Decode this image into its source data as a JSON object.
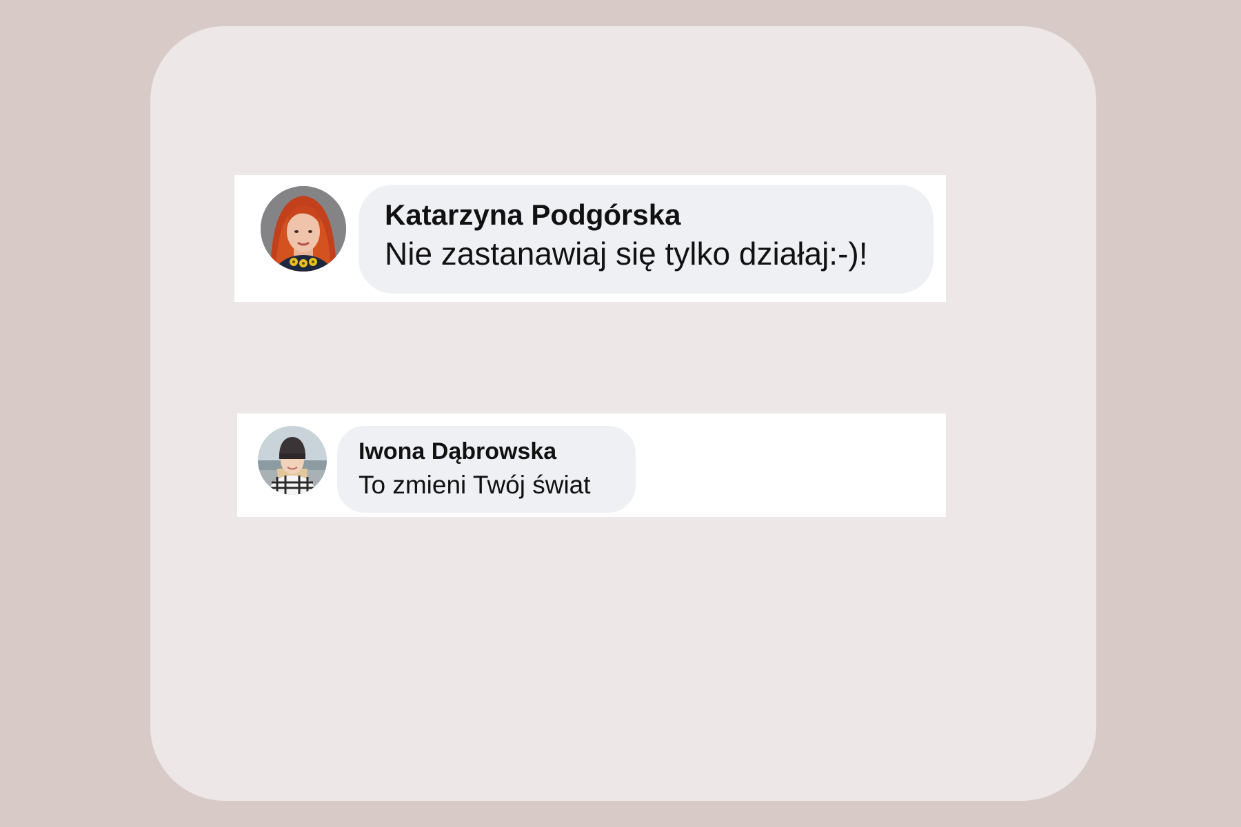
{
  "comments": [
    {
      "author": "Katarzyna Podgórska",
      "text": "Nie zastanawiaj się tylko działaj:-)!",
      "avatar_icon": "avatar-red-hair-woman"
    },
    {
      "author": "Iwona Dąbrowska",
      "text": "To zmieni Twój świat",
      "avatar_icon": "avatar-woman-beanie"
    }
  ],
  "colors": {
    "page_background": "#d8cbc7",
    "card_background": "#ede7e7",
    "comment_background": "#ffffff",
    "bubble_background": "#eff0f4",
    "text": "#111111"
  }
}
